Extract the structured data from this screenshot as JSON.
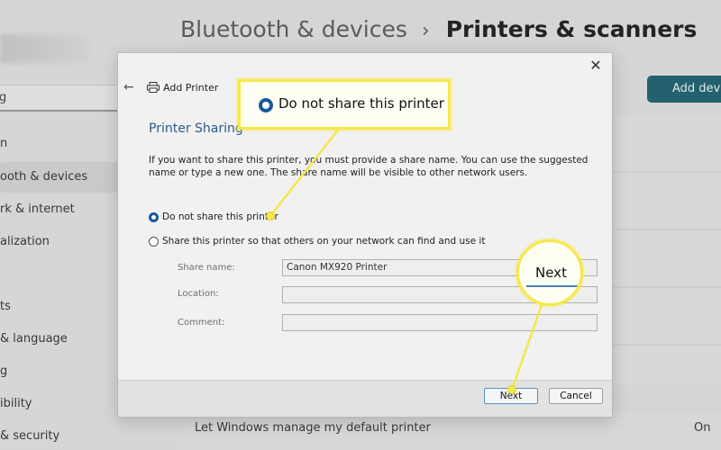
{
  "background": {
    "breadcrumb": {
      "parent": "Bluetooth & devices",
      "separator": "›",
      "current": "Printers & scanners"
    },
    "search_value": "g",
    "nav_items": [
      "n",
      "ooth & devices",
      "rk & internet",
      "alization",
      "ts",
      "& language",
      "g",
      "ibility",
      "& security"
    ],
    "add_device_label": "Add devic",
    "default_printer_label": "Let Windows manage my default printer",
    "default_printer_value": "On"
  },
  "dialog": {
    "close_glyph": "✕",
    "back_glyph": "←",
    "app_title": "Add Printer",
    "heading": "Printer Sharing",
    "description": "If you want to share this printer, you must provide a share name. You can use the suggested name or type a new one. The share name will be visible to other network users.",
    "options": {
      "no_share": "Do not share this printer",
      "share": "Share this printer so that others on your network can find and use it"
    },
    "selected_option": "no_share",
    "fields": {
      "share_name": {
        "label": "Share name:",
        "value": "Canon MX920 Printer"
      },
      "location": {
        "label": "Location:",
        "value": ""
      },
      "comment": {
        "label": "Comment:",
        "value": ""
      }
    },
    "buttons": {
      "next": "Next",
      "cancel": "Cancel"
    }
  },
  "callouts": {
    "share_option": "Do not share this printer",
    "next_button": "Next"
  },
  "colors": {
    "accent_blue": "#175a9d",
    "highlight_yellow": "#f5e84a",
    "add_button": "#0f5c6b"
  }
}
